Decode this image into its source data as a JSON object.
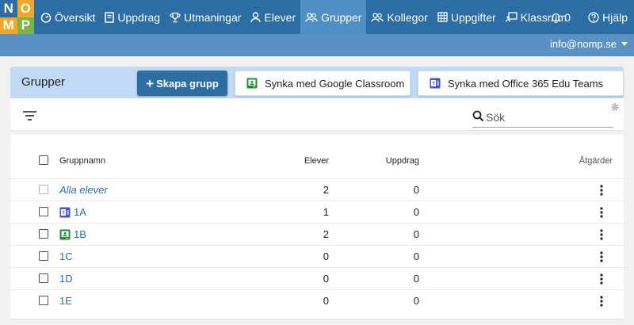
{
  "logo": {
    "letters": [
      "N",
      "O",
      "M",
      "P"
    ],
    "colors": [
      "#2c6da3",
      "#f5a623",
      "#f5a623",
      "#7cb342"
    ]
  },
  "nav": {
    "items": [
      {
        "label": "Översikt",
        "icon": "gauge-icon",
        "active": false
      },
      {
        "label": "Uppdrag",
        "icon": "book-icon",
        "active": false
      },
      {
        "label": "Utmaningar",
        "icon": "trophy-icon",
        "active": false
      },
      {
        "label": "Elever",
        "icon": "user-icon",
        "active": false
      },
      {
        "label": "Grupper",
        "icon": "users-icon",
        "active": true
      },
      {
        "label": "Kollegor",
        "icon": "users-icon",
        "active": false
      },
      {
        "label": "Uppgifter",
        "icon": "grid-icon",
        "active": false
      },
      {
        "label": "Klassrum",
        "icon": "classroom-icon",
        "active": false
      }
    ],
    "notifications": {
      "count": "0",
      "icon": "bell-icon"
    },
    "help": {
      "label": "Hjälp",
      "icon": "question-icon"
    }
  },
  "account": {
    "email": "info@nomp.se"
  },
  "page": {
    "title": "Grupper",
    "create_button": "Skapa grupp",
    "google_button": "Synka med Google Classroom",
    "office_button": "Synka med Office 365 Edu Teams"
  },
  "toolbar": {
    "search_placeholder": "Sök"
  },
  "table": {
    "headers": {
      "name": "Gruppnamn",
      "students": "Elever",
      "assignments": "Uppdrag",
      "actions": "Åtgärder"
    },
    "rows": [
      {
        "name": "Alla elever",
        "students": "2",
        "assignments": "0",
        "source": "none",
        "italic": true
      },
      {
        "name": "1A",
        "students": "1",
        "assignments": "0",
        "source": "office",
        "italic": false
      },
      {
        "name": "1B",
        "students": "2",
        "assignments": "0",
        "source": "google",
        "italic": false
      },
      {
        "name": "1C",
        "students": "0",
        "assignments": "0",
        "source": "none",
        "italic": false
      },
      {
        "name": "1D",
        "students": "0",
        "assignments": "0",
        "source": "none",
        "italic": false
      },
      {
        "name": "1E",
        "students": "0",
        "assignments": "0",
        "source": "none",
        "italic": false
      }
    ]
  },
  "colors": {
    "primary": "#2c6da3",
    "active_tab": "#4f8fc6",
    "subbar": "#5a91c4",
    "header_panel": "#c0d9f5",
    "link": "#2b6fb3"
  }
}
